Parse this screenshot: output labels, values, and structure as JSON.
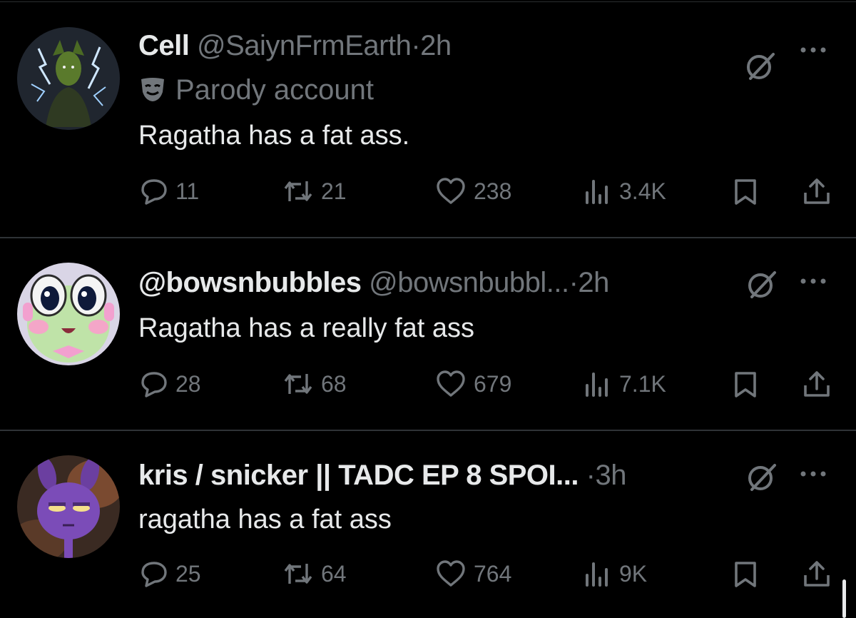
{
  "tweets": [
    {
      "name": "Cell",
      "handle": "@SaiynFrmEarth",
      "separator": "·",
      "time": "2h",
      "label": "Parody account",
      "text": "Ragatha has a fat ass.",
      "replies": "11",
      "reposts": "21",
      "likes": "238",
      "views": "3.4K"
    },
    {
      "name": "@bowsnbubbles",
      "handle": "@bowsnbubbl...",
      "separator": "·",
      "time": "2h",
      "text": "Ragatha has a really fat ass",
      "replies": "28",
      "reposts": "68",
      "likes": "679",
      "views": "7.1K"
    },
    {
      "name": "kris / snicker || TADC EP 8 SPOI...",
      "handle": "",
      "separator": "·",
      "time": "3h",
      "text": "ragatha has a fat ass",
      "replies": "25",
      "reposts": "64",
      "likes": "764",
      "views": "9K"
    }
  ],
  "icons": {
    "reply": "reply-icon",
    "repost": "repost-icon",
    "like": "heart-icon",
    "views": "views-icon",
    "bookmark": "bookmark-icon",
    "share": "share-icon",
    "grok": "grok-icon",
    "more": "more-icon",
    "parody": "parody-mask-icon"
  },
  "colors": {
    "background": "#000000",
    "text": "#e7e9ea",
    "secondary": "#71767b",
    "divider": "#2f3336"
  }
}
